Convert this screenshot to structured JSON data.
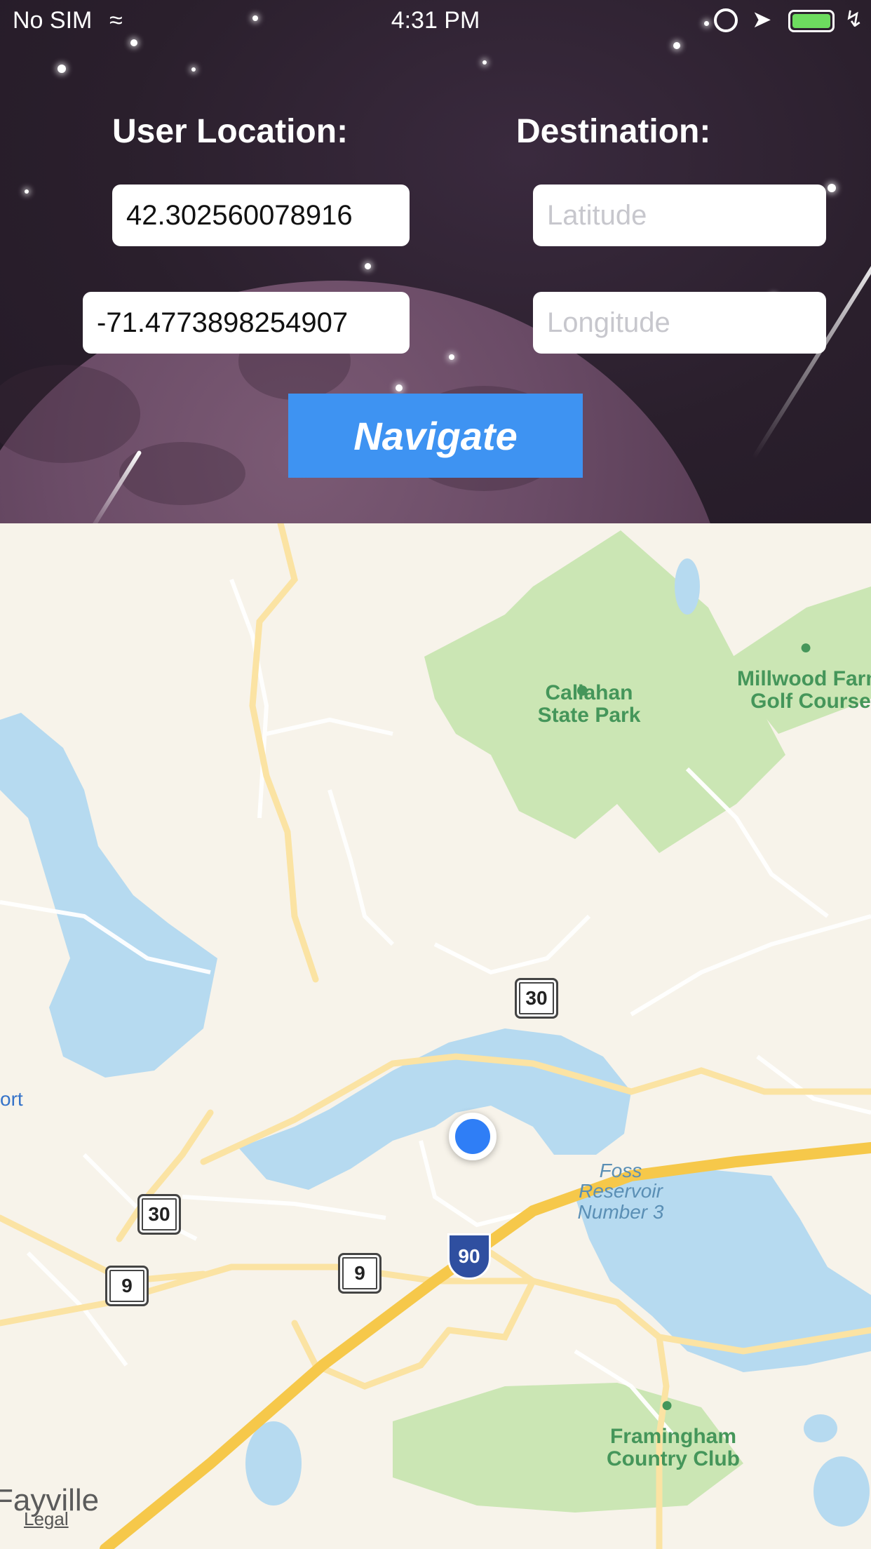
{
  "status_bar": {
    "carrier": "No SIM",
    "time": "4:31 PM",
    "icons": [
      "wifi-icon",
      "orientation-lock-icon",
      "location-arrow-icon",
      "battery-icon",
      "charging-bolt-icon"
    ],
    "battery_color": "#6ddc5f"
  },
  "user_location": {
    "heading": "User Location:",
    "latitude": "42.302560078916",
    "longitude": "-71.4773898254907"
  },
  "destination": {
    "heading": "Destination:",
    "latitude_placeholder": "Latitude",
    "longitude_placeholder": "Longitude"
  },
  "navigate_button": {
    "label": "Navigate",
    "color": "#3e93f2"
  },
  "map": {
    "labels": {
      "callahan": "Callahan State Park",
      "millwood": "Millwood Farm Golf Course",
      "foss": "Foss Reservoir Number 3",
      "framingham": "Framingham Country Club",
      "fayville": "Fayville",
      "port": "ort"
    },
    "shields": {
      "route30_a": "30",
      "route30_b": "30",
      "route9_a": "9",
      "route9_b": "9",
      "interstate": "90"
    },
    "legal": "Legal",
    "colors": {
      "water": "#b6daf0",
      "park": "#cbe6b4",
      "highway": "#f6c84a",
      "road": "#fbe3a3",
      "land": "#f7f3ea"
    }
  }
}
